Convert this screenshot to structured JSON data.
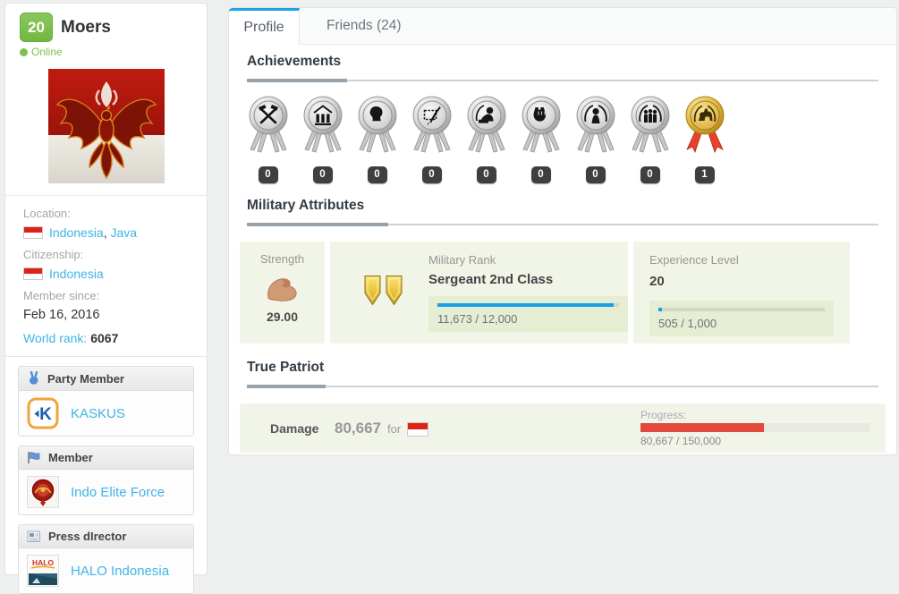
{
  "colors": {
    "accent_blue": "#19a3e8",
    "level_green": "#7cc04e",
    "link_blue": "#41b4e6",
    "patriot_red": "#e2483c",
    "card_green_bg": "#f1f5e8",
    "flag_red": "#dd2314"
  },
  "sidebar": {
    "level": "20",
    "name": "Moers",
    "status": "Online",
    "info": {
      "location_label": "Location:",
      "location_country": "Indonesia",
      "location_sep": ",",
      "location_region": "Java",
      "citizenship_label": "Citizenship:",
      "citizenship_country": "Indonesia",
      "member_since_label": "Member since:",
      "member_since_value": "Feb 16, 2016",
      "world_rank_label": "World rank:",
      "world_rank_value": "6067"
    },
    "orgs": [
      {
        "role": "Party Member",
        "icon": "victory-hand-icon",
        "name": "KASKUS"
      },
      {
        "role": "Member",
        "icon": "flag-icon",
        "name": "Indo Elite Force"
      },
      {
        "role": "Press dIrector",
        "icon": "newspaper-icon",
        "name": "HALO Indonesia"
      }
    ]
  },
  "main": {
    "tabs": [
      {
        "label": "Profile",
        "active": true
      },
      {
        "label": "Friends (24)",
        "active": false
      }
    ],
    "achievements": {
      "title": "Achievements",
      "medals": [
        {
          "name": "hard-worker-medal",
          "tier": "silver",
          "count": "0"
        },
        {
          "name": "congress-medal",
          "tier": "silver",
          "count": "0"
        },
        {
          "name": "country-president-medal",
          "tier": "silver",
          "count": "0"
        },
        {
          "name": "media-mogul-medal",
          "tier": "silver",
          "count": "0"
        },
        {
          "name": "battle-hero-medal",
          "tier": "silver",
          "count": "0"
        },
        {
          "name": "resistance-hero-medal",
          "tier": "silver",
          "count": "0"
        },
        {
          "name": "super-soldier-medal",
          "tier": "silver",
          "count": "0"
        },
        {
          "name": "society-builder-medal",
          "tier": "silver",
          "count": "0"
        },
        {
          "name": "true-patriot-medal",
          "tier": "gold",
          "count": "1"
        }
      ]
    },
    "military": {
      "title": "Military Attributes",
      "strength": {
        "label": "Strength",
        "value": "29.00"
      },
      "rank": {
        "label": "Military Rank",
        "value": "Sergeant 2nd Class",
        "progress_text": "11,673 / 12,000",
        "progress_pct": 97
      },
      "experience": {
        "label": "Experience Level",
        "value": "20",
        "progress_text": "505 / 1,000",
        "progress_pct": 2
      }
    },
    "true_patriot": {
      "title": "True Patriot",
      "damage_label": "Damage",
      "damage_value": "80,667",
      "for_text": "for",
      "progress_label": "Progress:",
      "progress_text": "80,667 / 150,000",
      "progress_pct": 54
    }
  }
}
